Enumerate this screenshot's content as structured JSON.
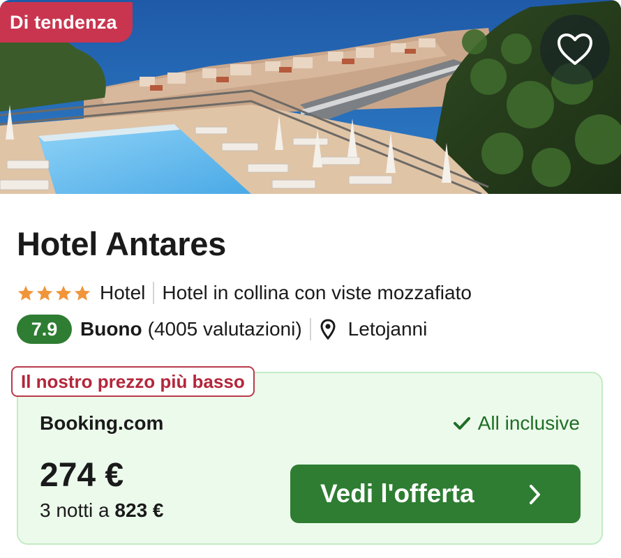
{
  "hero": {
    "badge": "Di tendenza",
    "image_alt_icon": "hotel-pool-sea-view-photo"
  },
  "hotel": {
    "name": "Hotel Antares",
    "stars": 4,
    "type": "Hotel",
    "tagline": "Hotel in collina con viste mozzafiato",
    "score": "7.9",
    "score_word": "Buono",
    "reviews": "(4005 valutazioni)",
    "location": "Letojanni"
  },
  "offer": {
    "tag": "Il nostro prezzo più basso",
    "provider": "Booking.com",
    "inclusive": "All inclusive",
    "price": "274 €",
    "nights_prefix": "3 notti a",
    "nights_total": "823 €",
    "cta": "Vedi l'offerta"
  },
  "colors": {
    "badge": "#c9354f",
    "score": "#2e7d32",
    "cta": "#2e7d32",
    "offer_bg": "#ecfaec",
    "tag_text": "#b3263b",
    "star": "#f0953a"
  },
  "icons": [
    "heart-icon",
    "star-icon",
    "map-pin-icon",
    "check-icon",
    "chevron-right-icon"
  ]
}
